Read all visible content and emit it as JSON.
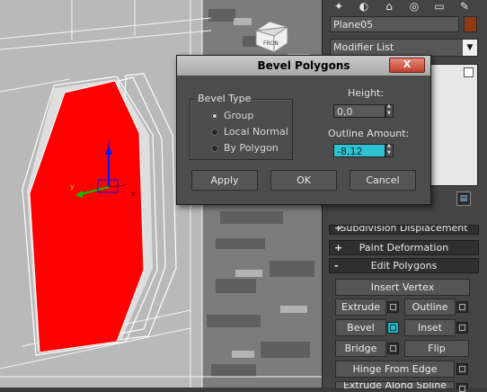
{
  "toolbar": {
    "icons": [
      "create-icon",
      "modify-icon",
      "hierarchy-icon",
      "motion-icon",
      "display-icon",
      "utilities-icon"
    ]
  },
  "object": {
    "name": "Plane05",
    "color": "#8f3a14"
  },
  "modifier_list": {
    "label": "Modifier List"
  },
  "viewport": {
    "cube_label": "FRON",
    "axis_z": "z",
    "axis_y": "y",
    "axis_x": "x",
    "polygon_color": "#ff0000"
  },
  "dialog": {
    "title": "Bevel Polygons",
    "close_label": "X",
    "bevel_type_label": "Bevel Type",
    "options": [
      "Group",
      "Local Normal",
      "By Polygon"
    ],
    "selected_option": "Group",
    "height_label": "Height:",
    "height_value": "0,0",
    "outline_label": "Outline Amount:",
    "outline_value": "-8,12",
    "apply_label": "Apply",
    "ok_label": "OK",
    "cancel_label": "Cancel"
  },
  "rollouts": {
    "subdivision": "Subdivision Displacement",
    "paint": "Paint Deformation",
    "edit": "Edit Polygons",
    "sign_plus": "+",
    "sign_minus": "-"
  },
  "edit_polygons": {
    "insert_vertex": "Insert Vertex",
    "extrude": "Extrude",
    "outline": "Outline",
    "bevel": "Bevel",
    "inset": "Inset",
    "bridge": "Bridge",
    "flip": "Flip",
    "hinge": "Hinge From Edge",
    "extrude_spline": "Extrude Along Spline"
  },
  "accent_color": "#2fc3d2"
}
